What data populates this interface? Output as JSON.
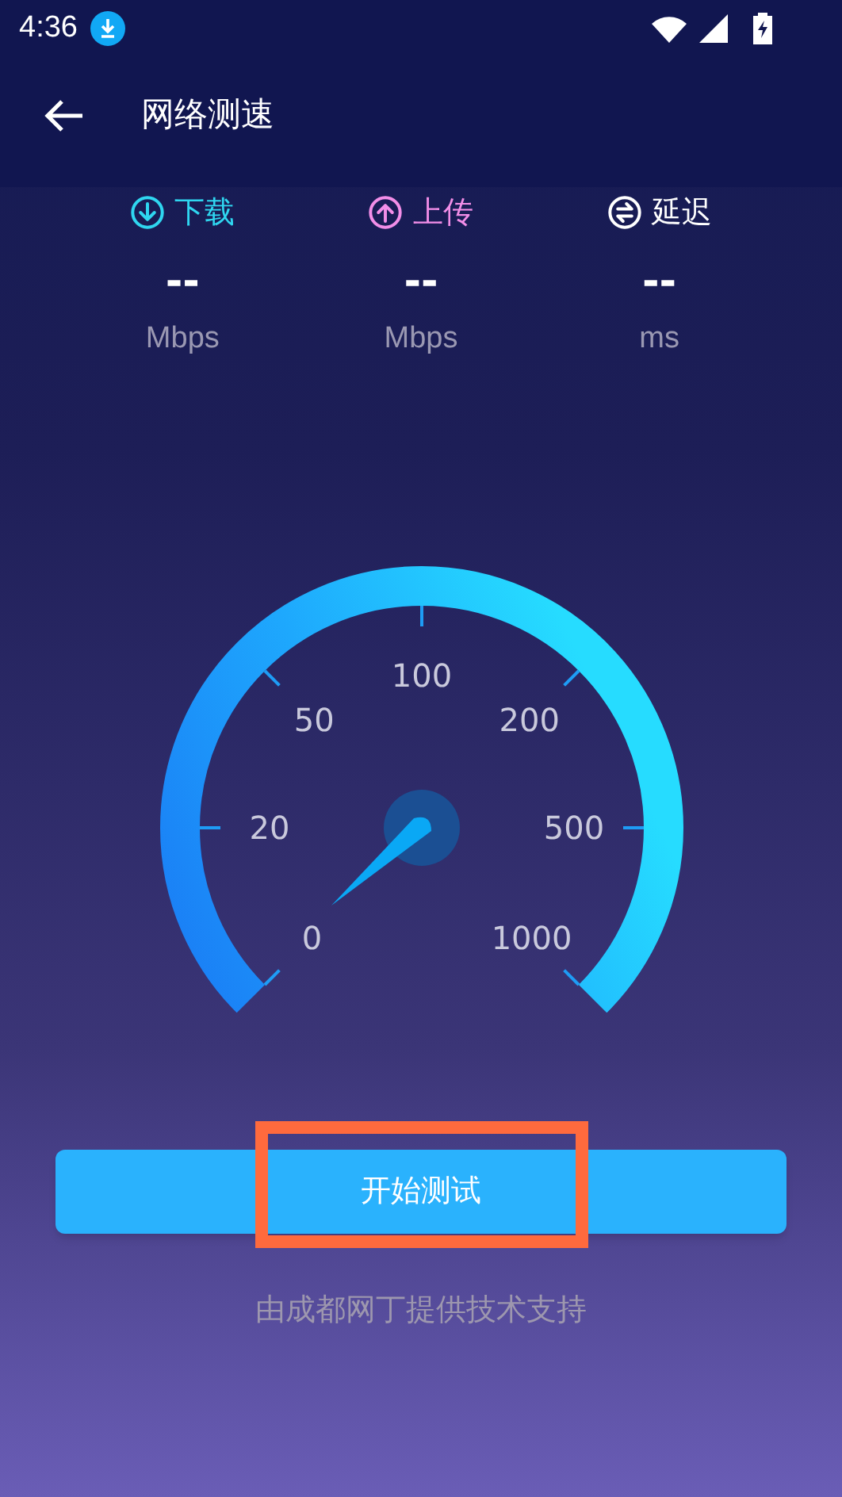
{
  "status_bar": {
    "time": "4:36"
  },
  "header": {
    "title": "网络测速"
  },
  "metrics": [
    {
      "kind": "download",
      "label": "下载",
      "color": "#2fd6f0",
      "value": "--",
      "unit": "Mbps"
    },
    {
      "kind": "upload",
      "label": "上传",
      "color": "#f28ee8",
      "value": "--",
      "unit": "Mbps"
    },
    {
      "kind": "latency",
      "label": "延迟",
      "color": "#ffffff",
      "value": "--",
      "unit": "ms"
    }
  ],
  "gauge": {
    "ticks": [
      "0",
      "20",
      "50",
      "100",
      "200",
      "500",
      "1000"
    ]
  },
  "start_button": {
    "label": "开始测试",
    "highlighted": true
  },
  "footer": {
    "text": "由成都网丁提供技术支持"
  }
}
